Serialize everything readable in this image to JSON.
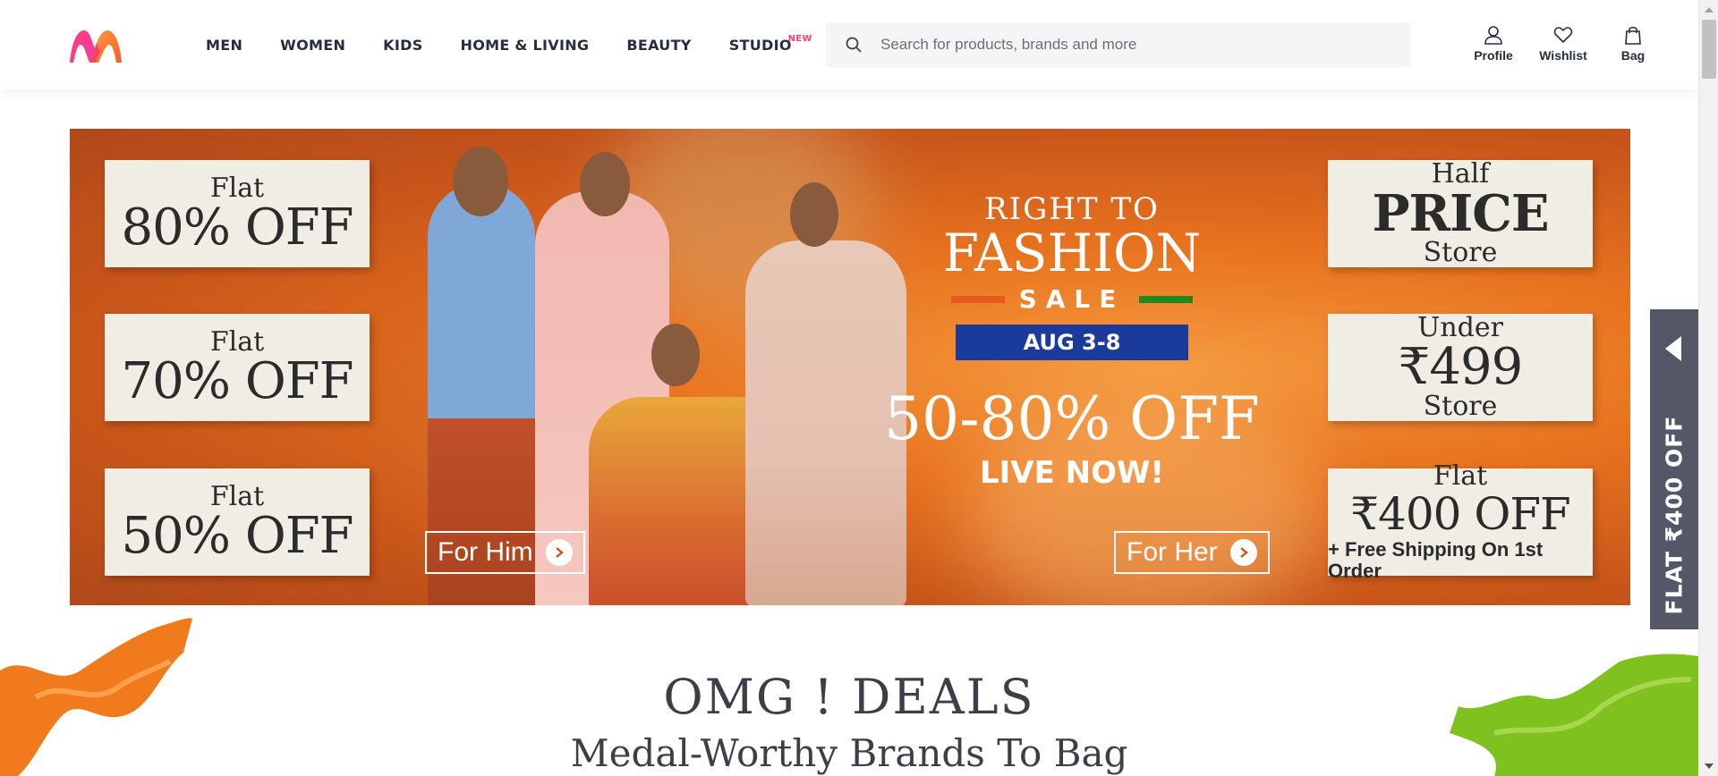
{
  "header": {
    "logo_alt": "Myntra",
    "nav": [
      {
        "label": "MEN"
      },
      {
        "label": "WOMEN"
      },
      {
        "label": "KIDS"
      },
      {
        "label": "HOME & LIVING"
      },
      {
        "label": "BEAUTY"
      },
      {
        "label": "STUDIO",
        "badge": "NEW"
      }
    ],
    "search": {
      "placeholder": "Search for products, brands and more",
      "icon": "search-icon"
    },
    "actions": [
      {
        "label": "Profile",
        "icon": "user-icon"
      },
      {
        "label": "Wishlist",
        "icon": "heart-icon"
      },
      {
        "label": "Bag",
        "icon": "bag-icon"
      }
    ]
  },
  "banner": {
    "left_tiles": [
      {
        "small": "Flat",
        "big": "80% OFF"
      },
      {
        "small": "Flat",
        "big": "70% OFF"
      },
      {
        "small": "Flat",
        "big": "50% OFF"
      }
    ],
    "right_tiles": [
      {
        "small": "Half",
        "big": "PRICE",
        "small2": "Store"
      },
      {
        "small": "Under",
        "big": "₹499",
        "small2": "Store"
      },
      {
        "small": "Flat",
        "big": "₹400 OFF",
        "sub": "+ Free Shipping On 1st Order"
      }
    ],
    "headline_top": "RIGHT TO",
    "headline_main": "FASHION",
    "sale_word": "SALE",
    "dates": "AUG 3-8",
    "discount": "50-80% OFF",
    "live": "LIVE NOW!",
    "cta_him": "For Him",
    "cta_her": "For Her"
  },
  "side_tab": {
    "text": "FLAT ₹400 OFF"
  },
  "deals": {
    "title": "OMG ! DEALS",
    "subtitle": "Medal-Worthy Brands To Bag"
  },
  "colors": {
    "brand_pink": "#ff3f6c",
    "banner_orange": "#e8731f",
    "dates_blue": "#1a3a9c",
    "side_tab": "#535766"
  }
}
